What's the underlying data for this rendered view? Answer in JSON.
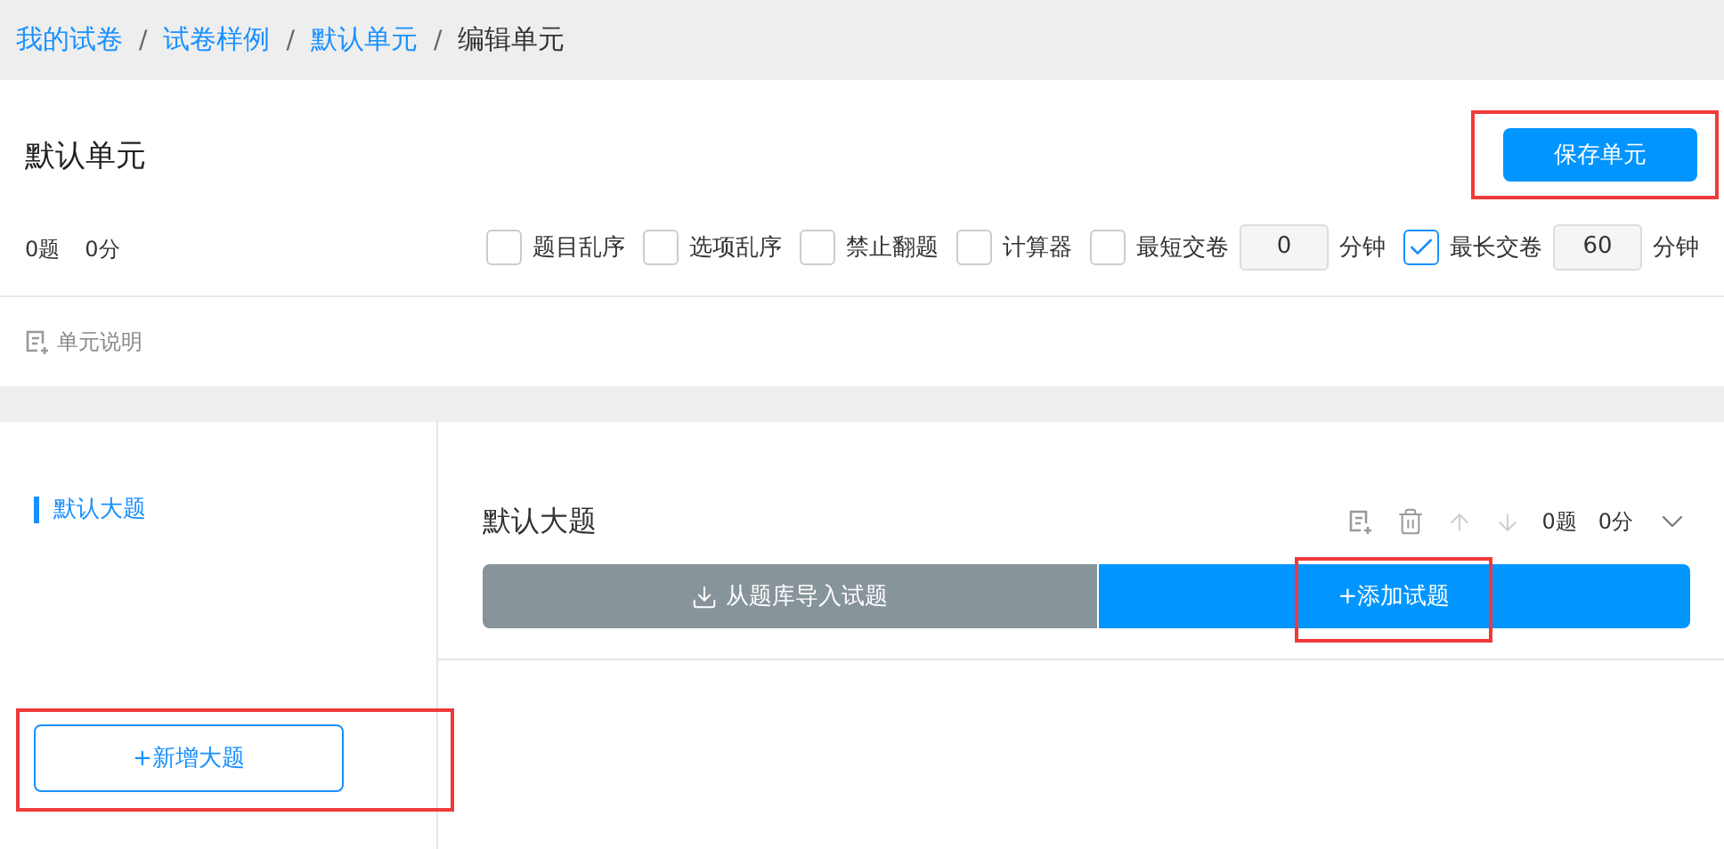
{
  "breadcrumb": [
    {
      "label": "我的试卷",
      "current": false
    },
    {
      "separator": "/",
      "label": "试卷样例",
      "current": false
    },
    {
      "separator": "/",
      "label": "默认单元",
      "current": false
    },
    {
      "separator": "/",
      "label": "编辑单元",
      "current": true
    }
  ],
  "unit": {
    "title": "默认单元",
    "save_button": {
      "label": "保存单元",
      "highlighted": true
    },
    "count": "0题",
    "score": "0分",
    "options": [
      {
        "kind": "checkbox",
        "label": "题目乱序",
        "checked": false
      },
      {
        "kind": "checkbox",
        "label": "选项乱序",
        "checked": false
      },
      {
        "kind": "checkbox",
        "label": "禁止翻题",
        "checked": false
      },
      {
        "kind": "checkbox",
        "label": "计算器",
        "checked": false
      },
      {
        "kind": "timer",
        "label": "最短交卷",
        "checked": false,
        "value": "0",
        "unit": "分钟"
      },
      {
        "kind": "timer",
        "label": "最长交卷",
        "checked": true,
        "value": "60",
        "unit": "分钟"
      }
    ],
    "note_link": "单元说明"
  },
  "sidebar": {
    "items": [
      {
        "label": "默认大题",
        "selected": true
      }
    ],
    "add_button": {
      "label": "+新增大题",
      "highlighted": true
    }
  },
  "section": {
    "title": "默认大题",
    "count": "0题",
    "score": "0分",
    "import_button": {
      "label": "从题库导入试题",
      "highlighted": false
    },
    "add_button": {
      "label": "+添加试题",
      "highlighted": true
    }
  }
}
